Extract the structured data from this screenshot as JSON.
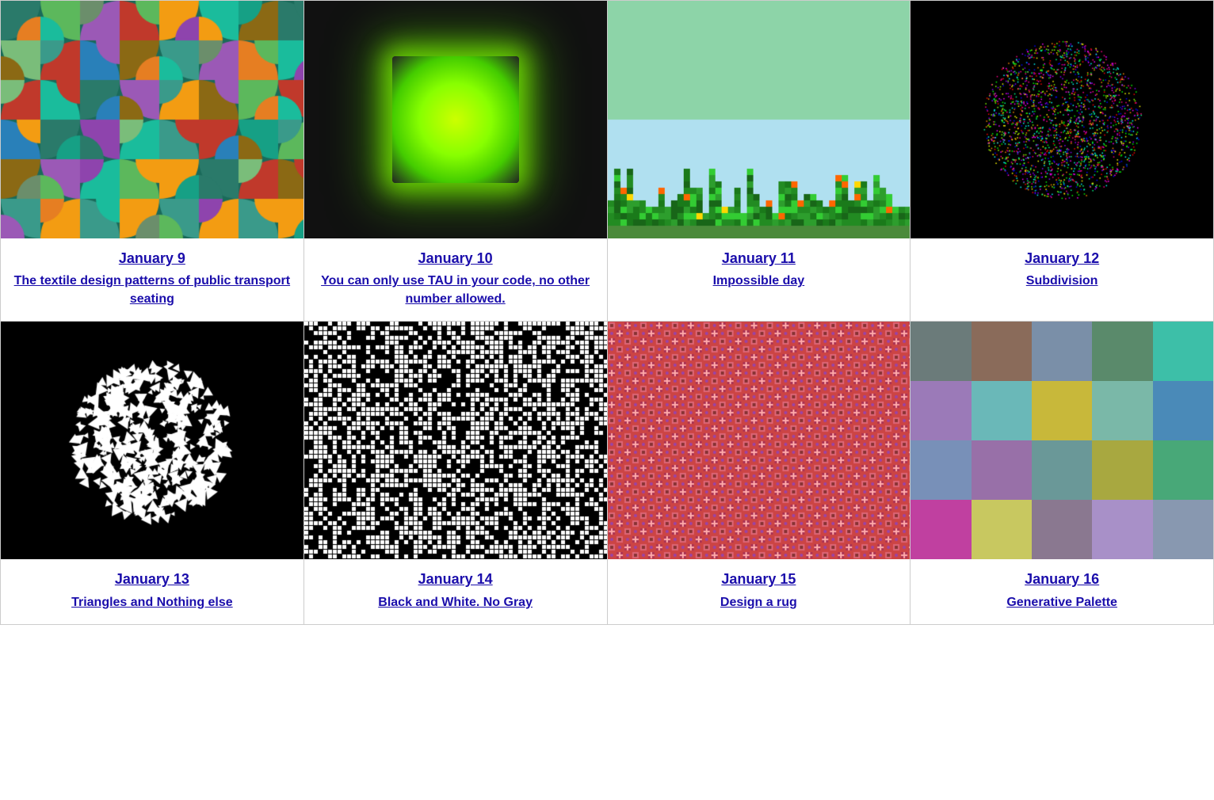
{
  "cards": [
    {
      "id": "jan9",
      "date": "January 9",
      "title": "The textile design patterns of public transport seating",
      "image_type": "textile"
    },
    {
      "id": "jan10",
      "date": "January 10",
      "title": "You can only use TAU in your code, no other number allowed.",
      "image_type": "glowing_square"
    },
    {
      "id": "jan11",
      "date": "January 11",
      "title": "Impossible day",
      "image_type": "pixel_landscape"
    },
    {
      "id": "jan12",
      "date": "January 12",
      "title": "Subdivision",
      "image_type": "particle_cluster"
    },
    {
      "id": "jan13",
      "date": "January 13",
      "title": "Triangles and Nothing else",
      "image_type": "triangle_cluster"
    },
    {
      "id": "jan14",
      "date": "January 14",
      "title": "Black and White. No Gray",
      "image_type": "bw_pattern"
    },
    {
      "id": "jan15",
      "date": "January 15",
      "title": "Design a rug",
      "image_type": "rug"
    },
    {
      "id": "jan16",
      "date": "January 16",
      "title": "Generative Palette",
      "image_type": "palette",
      "colors": [
        "#6b7b7a",
        "#8a6b5a",
        "#7a8fa8",
        "#5a8a6b",
        "#3dbfa8",
        "#9b7ab8",
        "#6ab8b8",
        "#c8b83a",
        "#7ab8a8",
        "#4a8ab8",
        "#7890b8",
        "#9870a8",
        "#6a9898",
        "#a8a840",
        "#48a878",
        "#c040a0",
        "#c8c860",
        "#8a7890",
        "#a890c8",
        "#8898b0"
      ]
    }
  ]
}
